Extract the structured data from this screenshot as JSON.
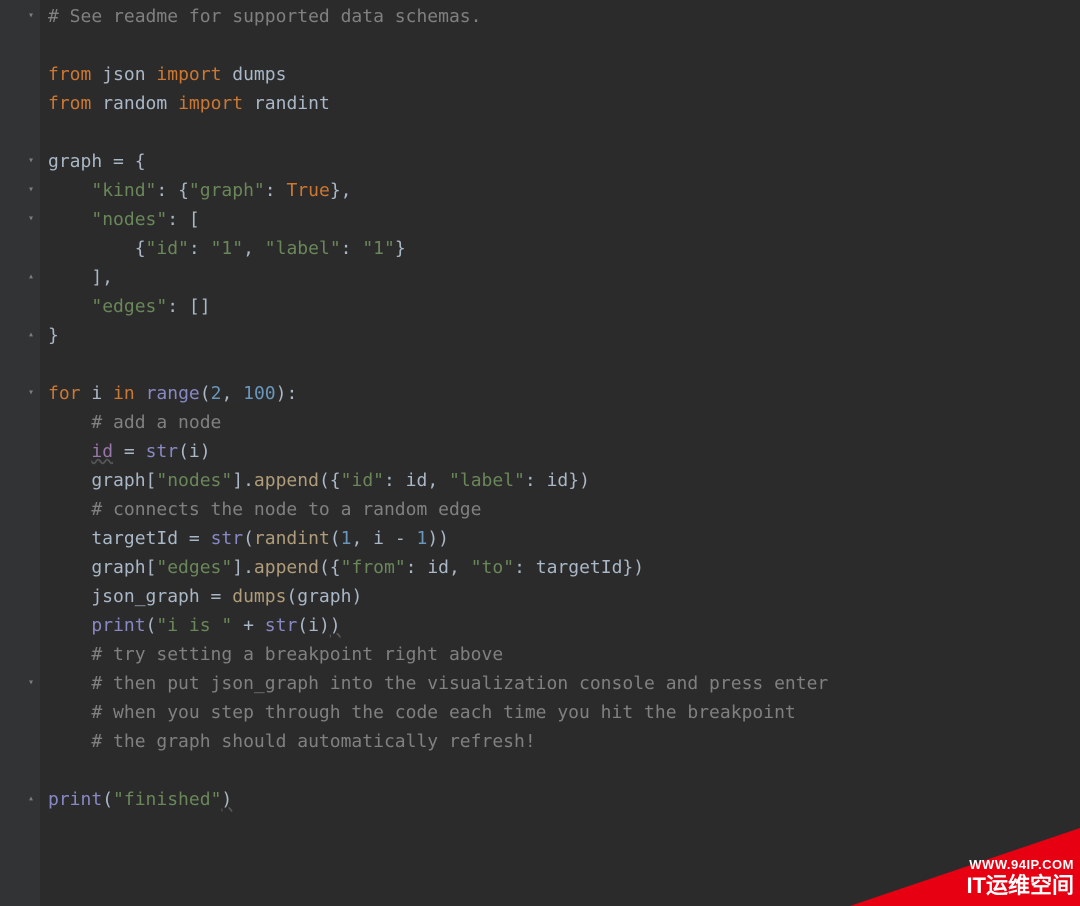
{
  "watermark": {
    "url": "WWW.94IP.COM",
    "brand": "IT运维空间"
  },
  "gutter_fold_markers": [
    {
      "line": 1,
      "glyph": "▾"
    },
    {
      "line": 6,
      "glyph": "▾"
    },
    {
      "line": 7,
      "glyph": "▾"
    },
    {
      "line": 8,
      "glyph": "▾"
    },
    {
      "line": 10,
      "glyph": "▴"
    },
    {
      "line": 12,
      "glyph": "▴"
    },
    {
      "line": 14,
      "glyph": "▾"
    },
    {
      "line": 24,
      "glyph": "▾"
    },
    {
      "line": 28,
      "glyph": "▴"
    }
  ],
  "code": {
    "l1": {
      "comment": "# See readme for supported data schemas."
    },
    "l3": {
      "kw1": "from",
      "mod": " json ",
      "kw2": "import",
      "name": " dumps"
    },
    "l4": {
      "kw1": "from",
      "mod": " random ",
      "kw2": "import",
      "name": " randint"
    },
    "l6": {
      "text": "graph = {"
    },
    "l7": {
      "indent": "    ",
      "key": "\"kind\"",
      "sep": ": {",
      "key2": "\"graph\"",
      "sep2": ": ",
      "val": "True",
      "end": "},"
    },
    "l8": {
      "indent": "    ",
      "key": "\"nodes\"",
      "sep": ": ["
    },
    "l9": {
      "indent": "        {",
      "key1": "\"id\"",
      "sep1": ": ",
      "val1": "\"1\"",
      "comma": ", ",
      "key2": "\"label\"",
      "sep2": ": ",
      "val2": "\"1\"",
      "end": "}"
    },
    "l10": {
      "text": "    ],"
    },
    "l11": {
      "indent": "    ",
      "key": "\"edges\"",
      "sep": ": []"
    },
    "l12": {
      "text": "}"
    },
    "l14": {
      "kw1": "for",
      "var": " i ",
      "kw2": "in",
      "sp": " ",
      "fn": "range",
      "open": "(",
      "n1": "2",
      "comma": ", ",
      "n2": "100",
      "close": "):"
    },
    "l15": {
      "comment": "    # add a node"
    },
    "l16": {
      "indent": "    ",
      "var": "id",
      "assign": " = ",
      "fn": "str",
      "open": "(",
      "arg": "i",
      "close": ")"
    },
    "l17": {
      "indent": "    graph[",
      "key": "\"nodes\"",
      "mid": "].",
      "fn": "append",
      "open": "({",
      "k1": "\"id\"",
      "s1": ": id, ",
      "k2": "\"label\"",
      "s2": ": id})"
    },
    "l18": {
      "comment": "    # connects the node to a random edge"
    },
    "l19": {
      "indent": "    targetId = ",
      "fn1": "str",
      "open1": "(",
      "fn2": "randint",
      "open2": "(",
      "n1": "1",
      "mid": ", i - ",
      "n2": "1",
      "close": "))"
    },
    "l20": {
      "indent": "    graph[",
      "key": "\"edges\"",
      "mid": "].",
      "fn": "append",
      "open": "({",
      "k1": "\"from\"",
      "s1": ": id, ",
      "k2": "\"to\"",
      "s2": ": targetId})"
    },
    "l21": {
      "indent": "    json_graph = ",
      "fn": "dumps",
      "args": "(graph)"
    },
    "l22": {
      "indent": "    ",
      "fn": "print",
      "open": "(",
      "str": "\"i is \"",
      "plus": " + ",
      "fn2": "str",
      "args2": "(i)",
      "close": ")"
    },
    "l23": {
      "comment": "    # try setting a breakpoint right above"
    },
    "l24": {
      "comment": "    # then put json_graph into the visualization console and press enter"
    },
    "l25": {
      "comment": "    # when you step through the code each time you hit the breakpoint"
    },
    "l26": {
      "comment": "    # the graph should automatically refresh!"
    },
    "l28": {
      "fn": "print",
      "open": "(",
      "str": "\"finished\"",
      "close": ")"
    }
  }
}
